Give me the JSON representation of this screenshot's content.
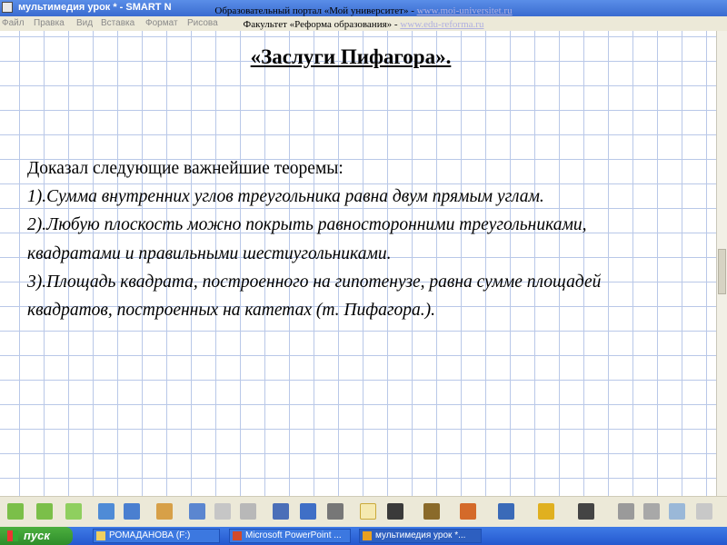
{
  "window": {
    "title": "мультимедия урок * - SMART N"
  },
  "menu": [
    "Файл",
    "Правка",
    "Вид",
    "Вставка",
    "Формат",
    "Рисова"
  ],
  "header": {
    "line1_text": "Образовательный портал «Мой университет» - ",
    "line1_url": "www.moi-universitet.ru",
    "line2_text": "Факультет «Реформа образования» - ",
    "line2_url": "www.edu-reforma.ru"
  },
  "slide": {
    "title": "«Заслуги Пифагора».",
    "intro": "Доказал следующие важнейшие теоремы:",
    "items": [
      "1).Сумма внутренних углов треугольника равна двум прямым углам.",
      "2).Любую плоскость можно покрыть равносторонними треугольниками, квадратами и правильными шестиугольниками.",
      "3).Площадь квадрата, построенного на гипотенузе, равна сумме площадей квадратов, построенных на катетах (т. Пифагора.)."
    ]
  },
  "taskbar": {
    "start_label": "пуск",
    "tasks": [
      {
        "label": "РОМАДАНОВА (F:)",
        "icon": "folder-icon"
      },
      {
        "label": "Microsoft PowerPoint ...",
        "icon": "powerpoint-icon"
      },
      {
        "label": "мультимедия урок *...",
        "icon": "smart-notebook-icon"
      }
    ]
  },
  "colors": {
    "grid": "#b9c8e8",
    "titlebar": "#3a6bd0",
    "taskbar": "#2458cf",
    "start": "#2e8d2a",
    "url": "#b0b0e0"
  }
}
